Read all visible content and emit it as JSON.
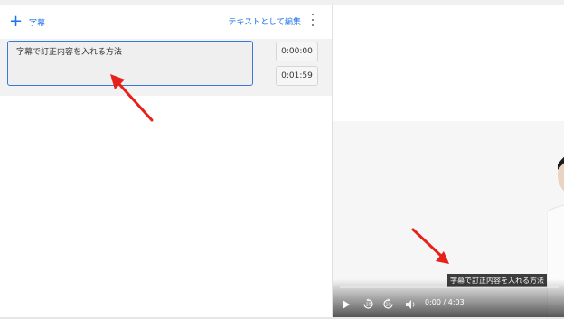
{
  "editor": {
    "add_label": "字幕",
    "edit_as_text": "テキストとして編集",
    "subtitles": [
      {
        "text": "字幕で訂正内容を入れる方法",
        "start": "0:00:00",
        "end": "0:01:59"
      }
    ]
  },
  "player": {
    "caption": "字幕で訂正内容を入れる方法",
    "time_display": "0:00 / 4:03",
    "progress": 0.0
  },
  "colors": {
    "accent": "#1a73e8",
    "annotation_arrow": "#e8201a",
    "selected_border": "#3a77d9"
  },
  "icons": [
    "plus-icon",
    "more-vert-icon",
    "play-icon",
    "rewind-10-icon",
    "forward-10-icon",
    "volume-icon"
  ]
}
